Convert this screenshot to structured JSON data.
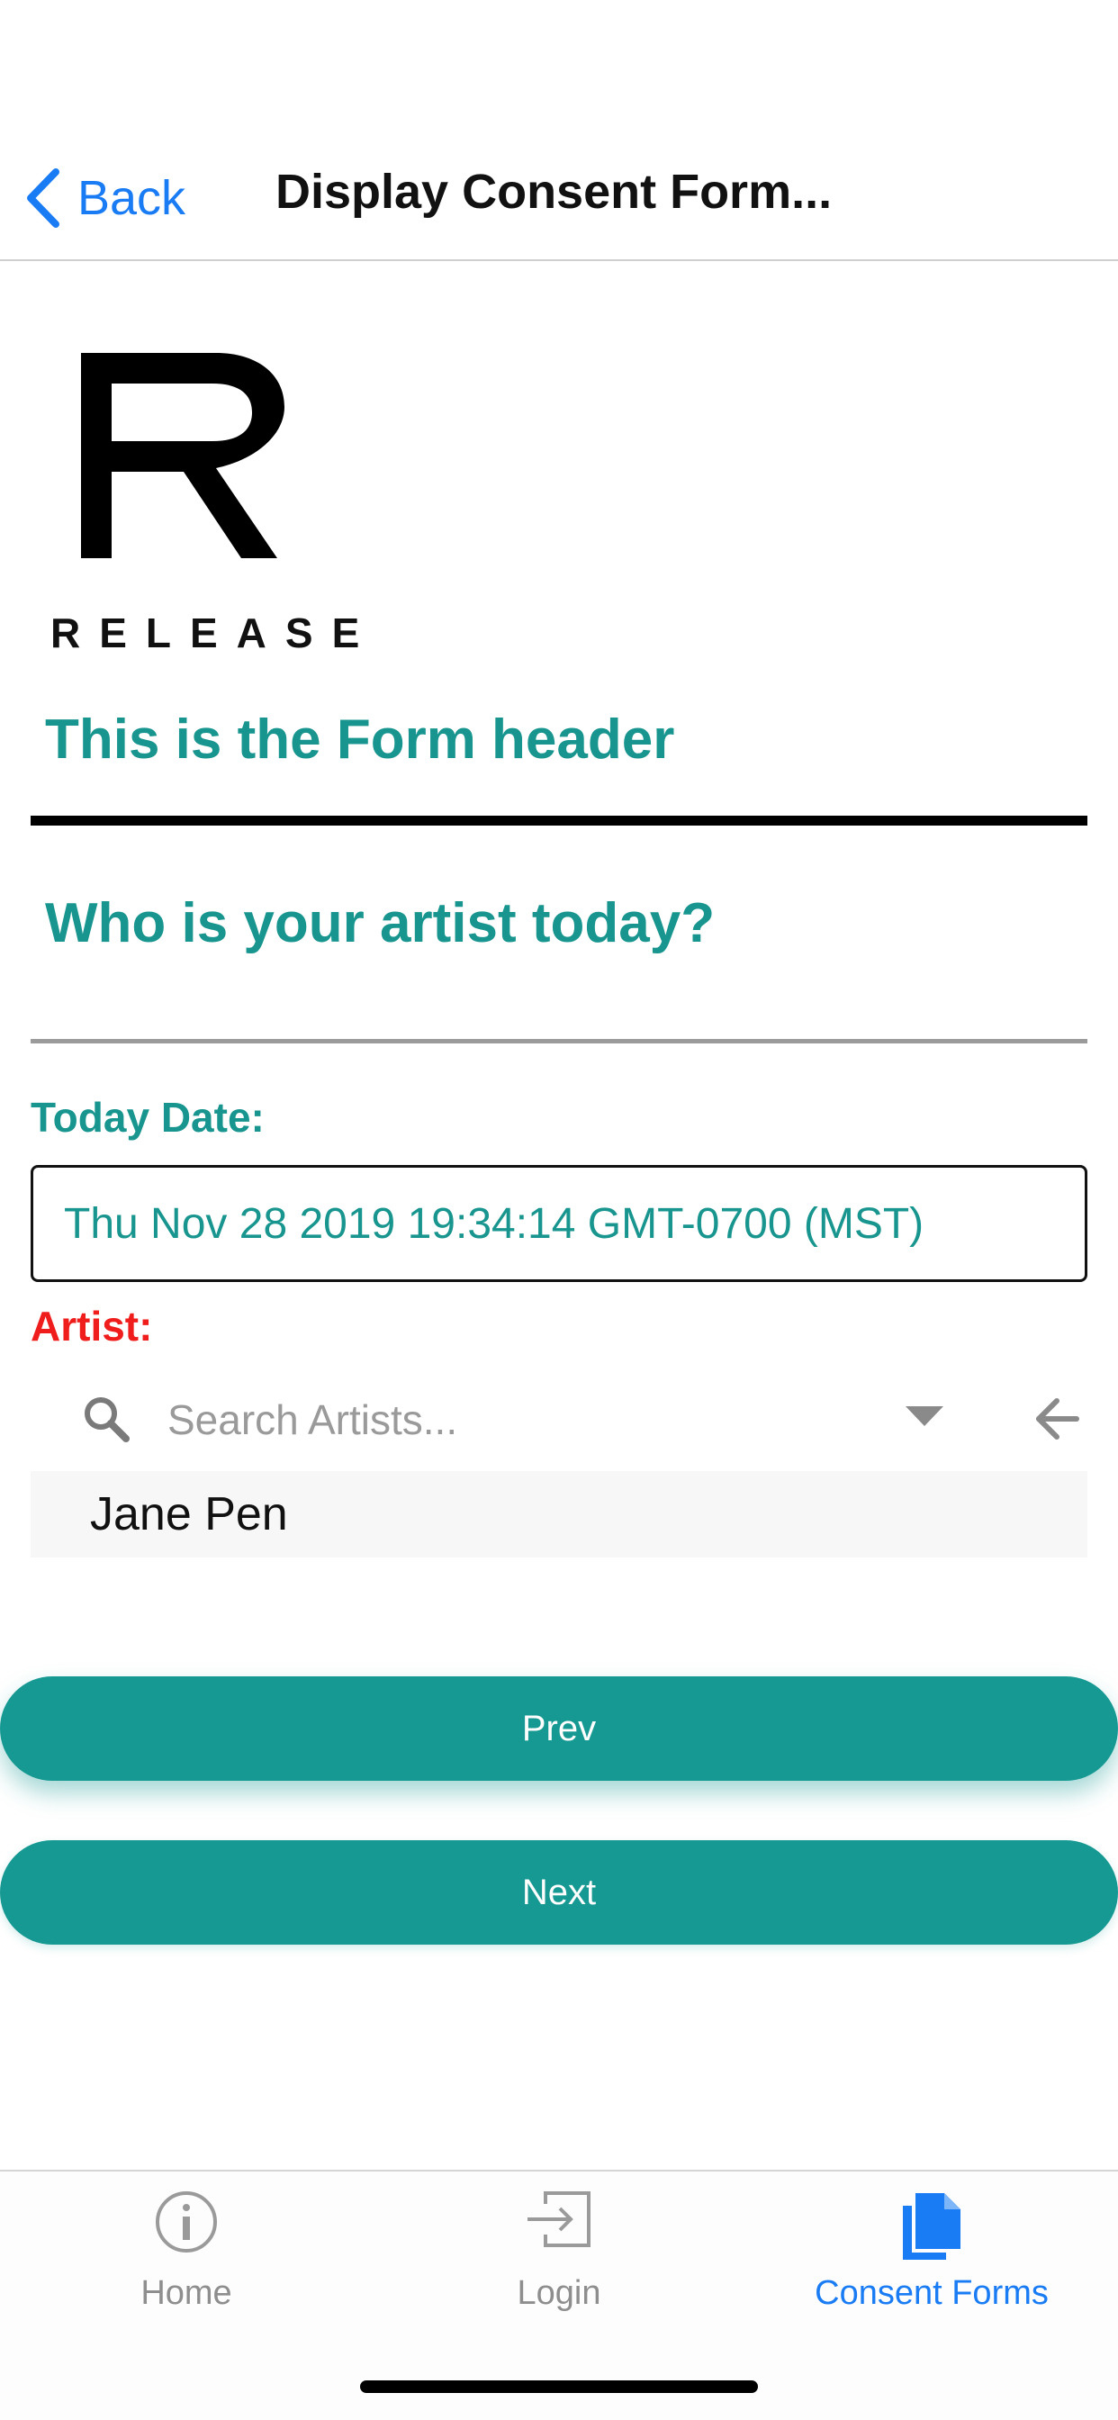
{
  "nav": {
    "back_label": "Back",
    "title": "Display Consent Form..."
  },
  "logo": {
    "brand_text": "RELEASE"
  },
  "form": {
    "header": "This is the Form header",
    "question": "Who is your artist today?",
    "date_label": "Today Date:",
    "date_value": "Thu Nov 28 2019 19:34:14 GMT-0700 (MST)",
    "artist_label": "Artist:",
    "artist_search_placeholder": "Search Artists...",
    "artist_results": [
      "Jane Pen"
    ]
  },
  "buttons": {
    "prev": "Prev",
    "next": "Next"
  },
  "tabbar": {
    "tabs": [
      {
        "label": "Home",
        "icon": "info-icon",
        "active": false
      },
      {
        "label": "Login",
        "icon": "login-icon",
        "active": false
      },
      {
        "label": "Consent Forms",
        "icon": "document-icon",
        "active": true
      }
    ]
  },
  "colors": {
    "accent_teal": "#17958e",
    "button_teal": "#169993",
    "ios_blue": "#1a7cf4",
    "required_red": "#f01d1d"
  }
}
